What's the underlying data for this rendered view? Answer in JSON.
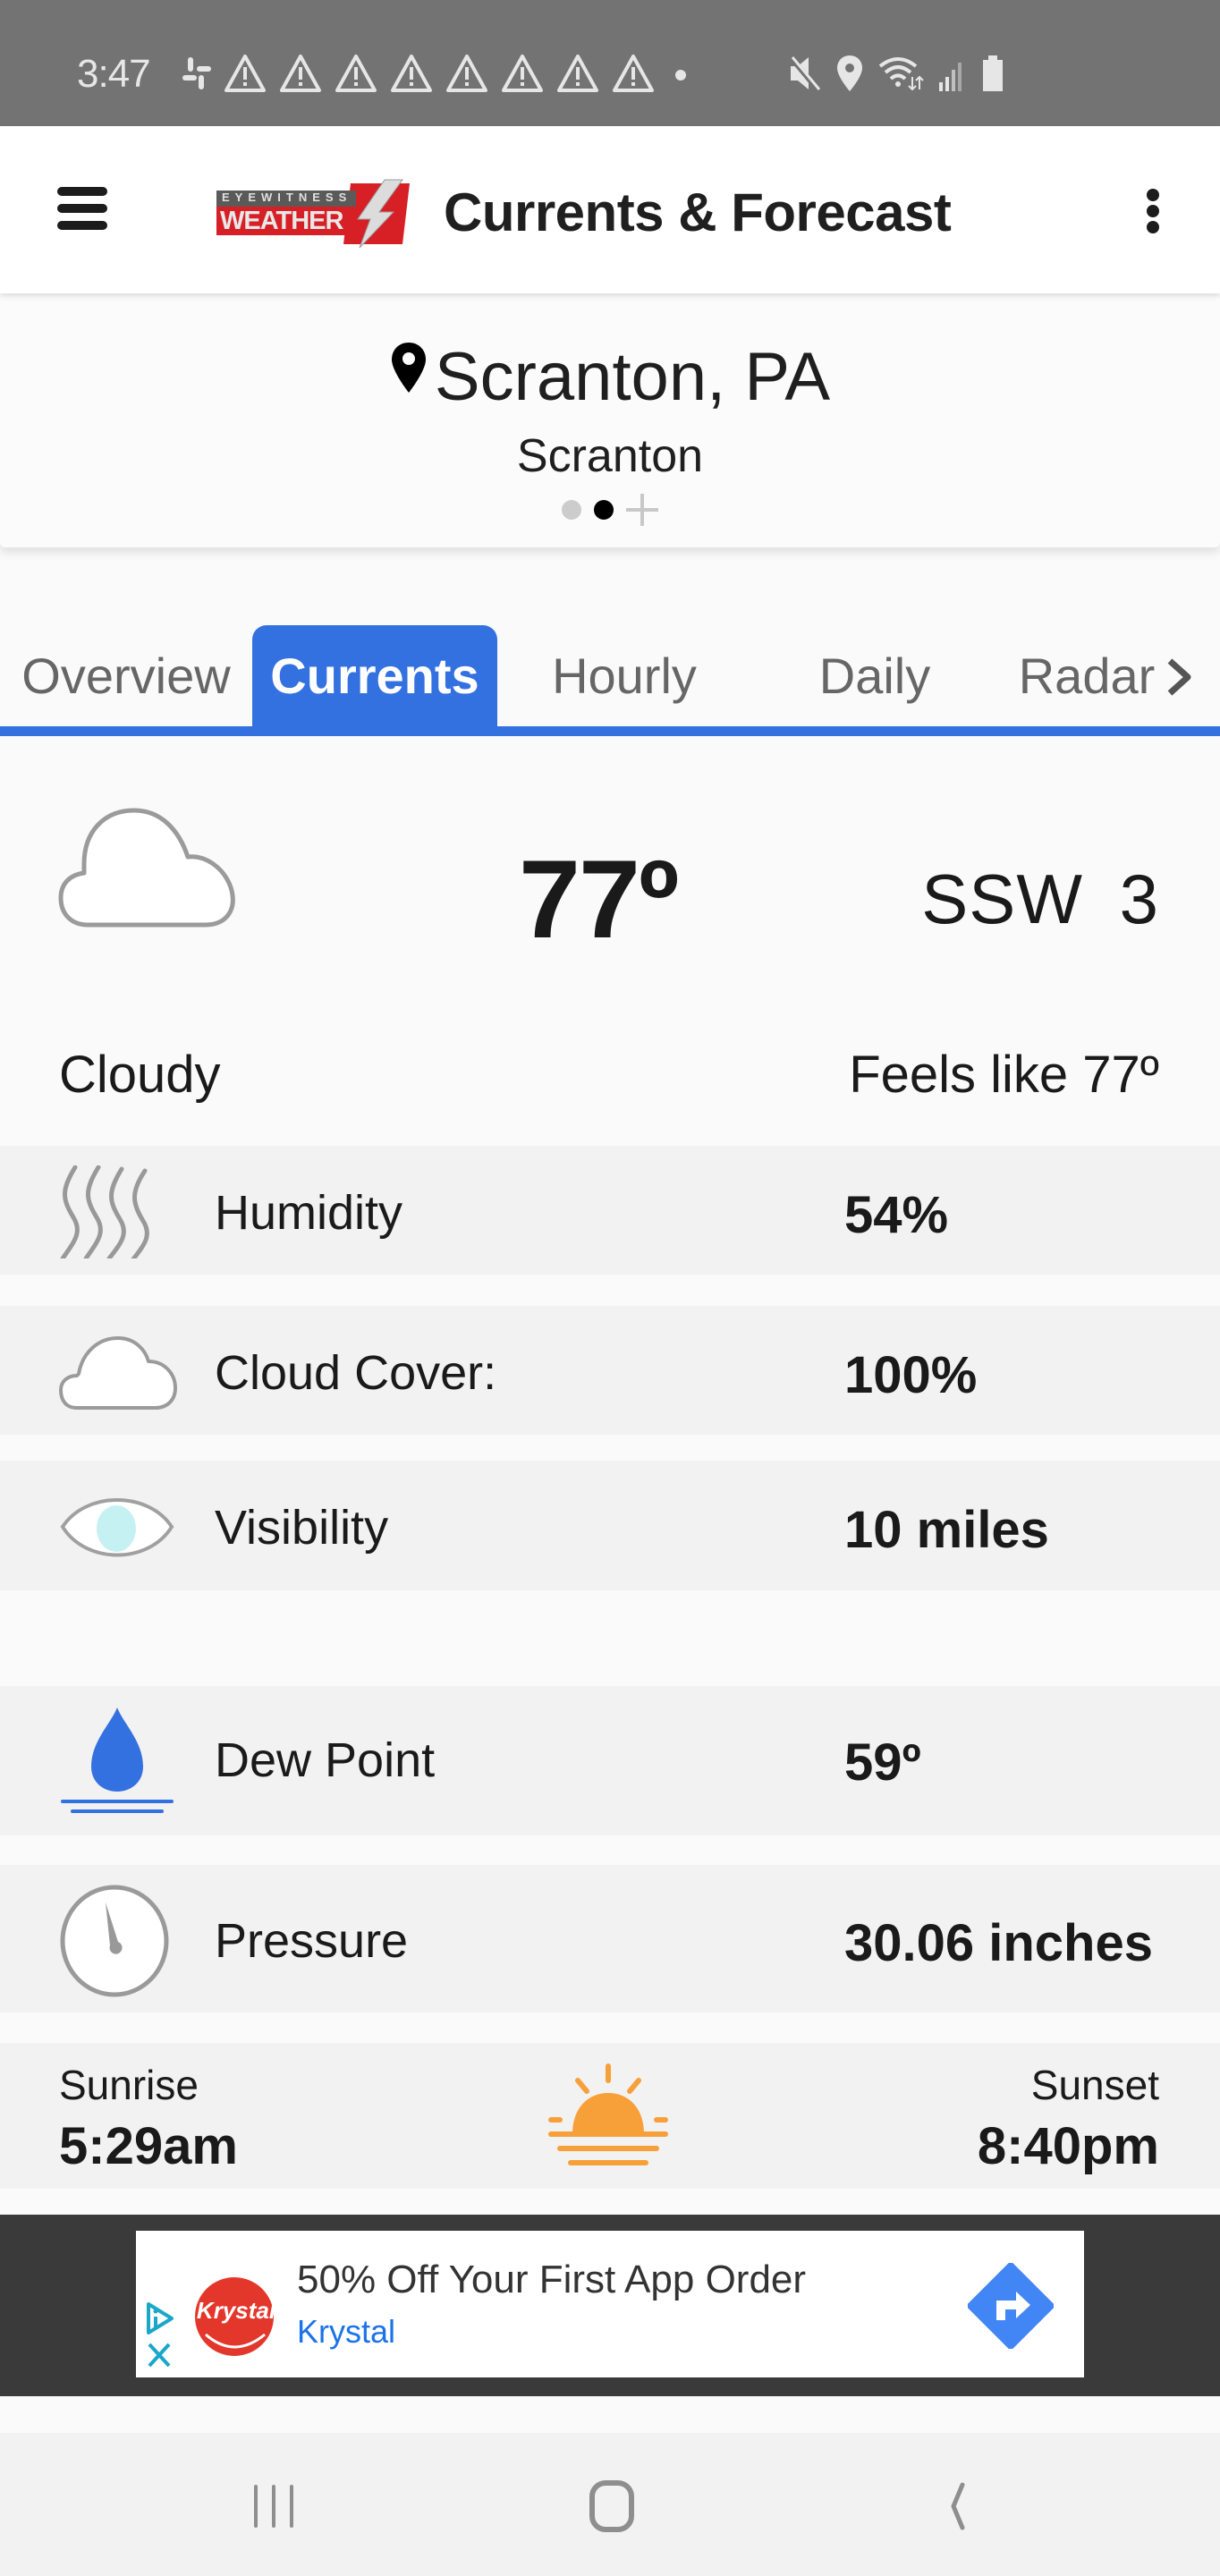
{
  "status_bar": {
    "time": "3:47",
    "left_icons": [
      "slack-icon",
      "warning-icon",
      "warning-icon",
      "warning-icon",
      "warning-icon",
      "warning-icon",
      "warning-icon",
      "warning-icon",
      "warning-icon",
      "dot-icon"
    ],
    "right_icons": [
      "mute-icon",
      "location-icon",
      "wifi-icon",
      "signal-icon",
      "battery-icon"
    ]
  },
  "app_bar": {
    "logo_top": "EYEWITNESS",
    "logo_bottom": "WEATHER",
    "title": "Currents & Forecast"
  },
  "location": {
    "name": "Scranton, PA",
    "subtitle": "Scranton",
    "pages": 2,
    "active_page": 2
  },
  "tabs": [
    {
      "label": "Overview",
      "active": false
    },
    {
      "label": "Currents",
      "active": true
    },
    {
      "label": "Hourly",
      "active": false
    },
    {
      "label": "Daily",
      "active": false
    },
    {
      "label": "Radar",
      "active": false
    }
  ],
  "current": {
    "icon": "cloud-icon",
    "temperature": "77º",
    "wind": "SSW 3",
    "condition": "Cloudy",
    "feels_like": "Feels like 77º"
  },
  "details": [
    {
      "icon": "humidity-icon",
      "label": "Humidity",
      "value": "54%"
    },
    {
      "icon": "cloud-icon",
      "label": "Cloud Cover:",
      "value": "100%"
    },
    {
      "icon": "eye-icon",
      "label": "Visibility",
      "value": "10 miles"
    },
    {
      "icon": "dew-drop-icon",
      "label": "Dew Point",
      "value": "59º"
    },
    {
      "icon": "gauge-icon",
      "label": "Pressure",
      "value": "30.06 inches"
    }
  ],
  "sun": {
    "sunrise_label": "Sunrise",
    "sunrise_time": "5:29am",
    "sunset_label": "Sunset",
    "sunset_time": "8:40pm"
  },
  "ad": {
    "logo_text": "Krystal",
    "headline": "50% Off Your First App Order",
    "brand": "Krystal"
  },
  "colors": {
    "accent": "#3471e0",
    "row_bg": "#f2f2f2",
    "sun": "#f7a03a",
    "dew": "#3471e0"
  }
}
